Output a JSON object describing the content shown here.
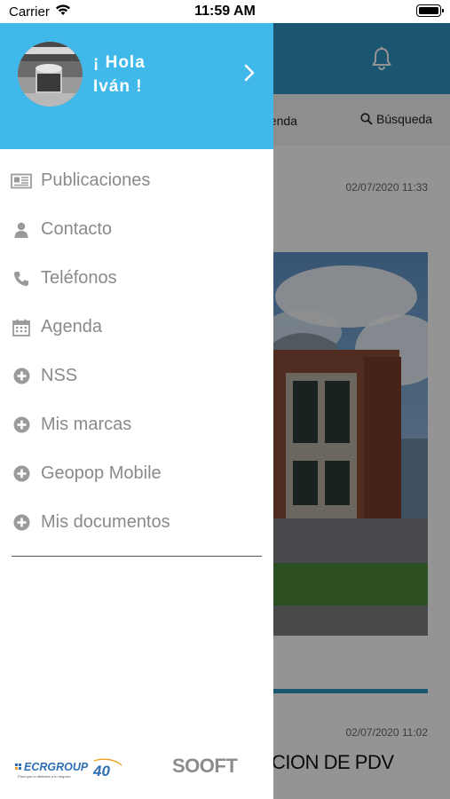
{
  "status_bar": {
    "carrier": "Carrier",
    "time": "11:59 AM"
  },
  "background_screen": {
    "tab_agenda": "genda",
    "search_label": "Búsqueda",
    "post1_date": "02/07/2020 11:33",
    "post2_date": "02/07/2020 11:02",
    "post2_title": "CION DE PDV"
  },
  "drawer": {
    "greeting_line1": "¡ Hola",
    "greeting_line2": "Iván !",
    "menu": [
      {
        "label": "Publicaciones",
        "icon": "newspaper-icon"
      },
      {
        "label": "Contacto",
        "icon": "user-icon"
      },
      {
        "label": "Teléfonos",
        "icon": "phone-icon"
      },
      {
        "label": "Agenda",
        "icon": "calendar-icon"
      },
      {
        "label": "NSS",
        "icon": "plus-circle-icon"
      },
      {
        "label": "Mis marcas",
        "icon": "plus-circle-icon"
      },
      {
        "label": "Geopop Mobile",
        "icon": "plus-circle-icon"
      },
      {
        "label": "Mis documentos",
        "icon": "plus-circle-icon"
      }
    ],
    "footer": {
      "ecr_logo_text": "ECRGROUP",
      "ecr_logo_number": "40",
      "ecr_logo_tagline": "Para que lo disfrutes a tu negocio",
      "sooft_logo_text": "SOOFT"
    }
  },
  "colors": {
    "drawer_header": "#41b8ea",
    "app_header": "#2f94c2",
    "menu_text": "#8a8a8a"
  }
}
